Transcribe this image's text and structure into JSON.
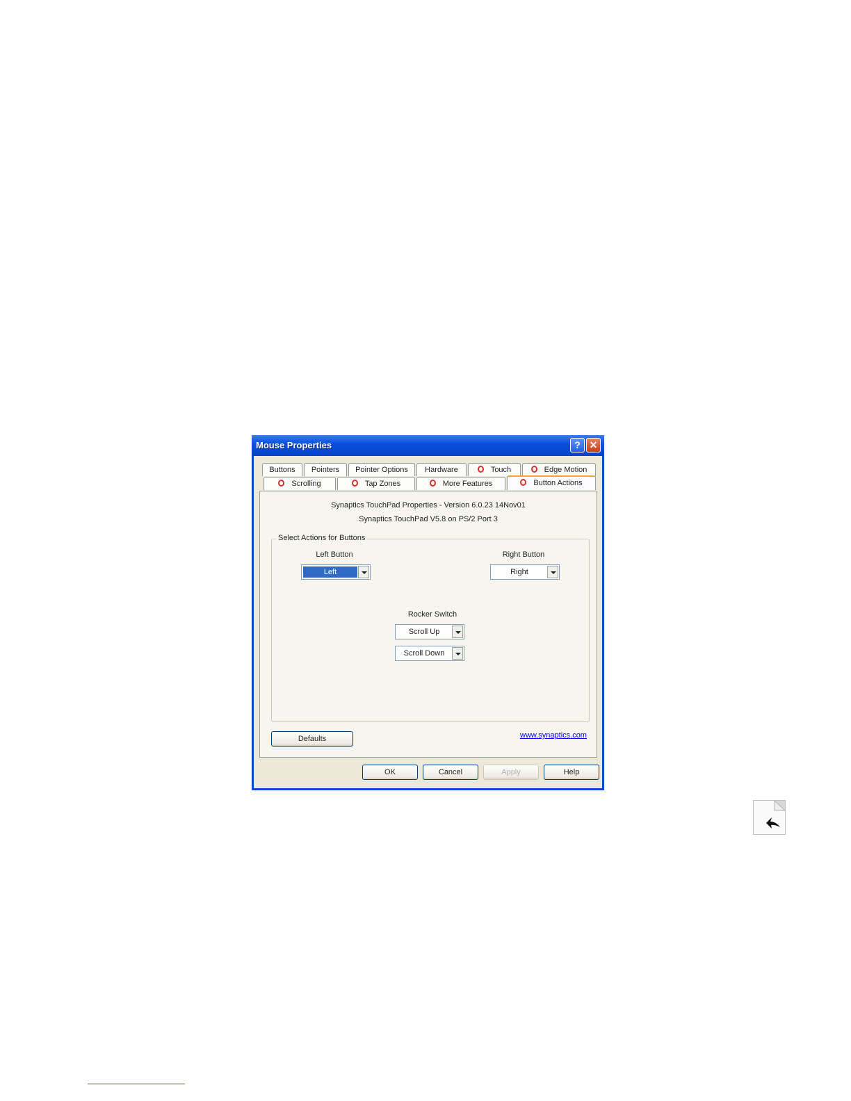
{
  "window": {
    "title": "Mouse Properties",
    "help_glyph": "?",
    "close_glyph": "✕"
  },
  "tabs_row1": [
    "Buttons",
    "Pointers",
    "Pointer Options",
    "Hardware",
    "Touch",
    "Edge Motion"
  ],
  "tabs_row2": [
    "Scrolling",
    "Tap Zones",
    "More Features",
    "Button Actions"
  ],
  "active_tab": "Button Actions",
  "info": {
    "version_line": "Synaptics TouchPad Properties - Version 6.0.23 14Nov01",
    "device_line": "Synaptics TouchPad V5.8 on PS/2 Port 3"
  },
  "group": {
    "label": "Select Actions for Buttons",
    "left_button": {
      "label": "Left Button",
      "value": "Left"
    },
    "right_button": {
      "label": "Right Button",
      "value": "Right"
    },
    "rocker": {
      "label": "Rocker Switch",
      "up_value": "Scroll Up",
      "down_value": "Scroll Down"
    }
  },
  "defaults_label": "Defaults",
  "link_text": "www.synaptics.com",
  "buttons": {
    "ok": "OK",
    "cancel": "Cancel",
    "apply": "Apply",
    "help": "Help"
  },
  "colors": {
    "titlebar": "#0a50dd",
    "selection": "#316ac5",
    "tab_highlight": "#f5a623",
    "dialog_bg": "#ece9d8"
  },
  "icons": {
    "synaptics_tab": "synaptics-swirl-icon",
    "page_corner": "curl-arrow-icon"
  }
}
